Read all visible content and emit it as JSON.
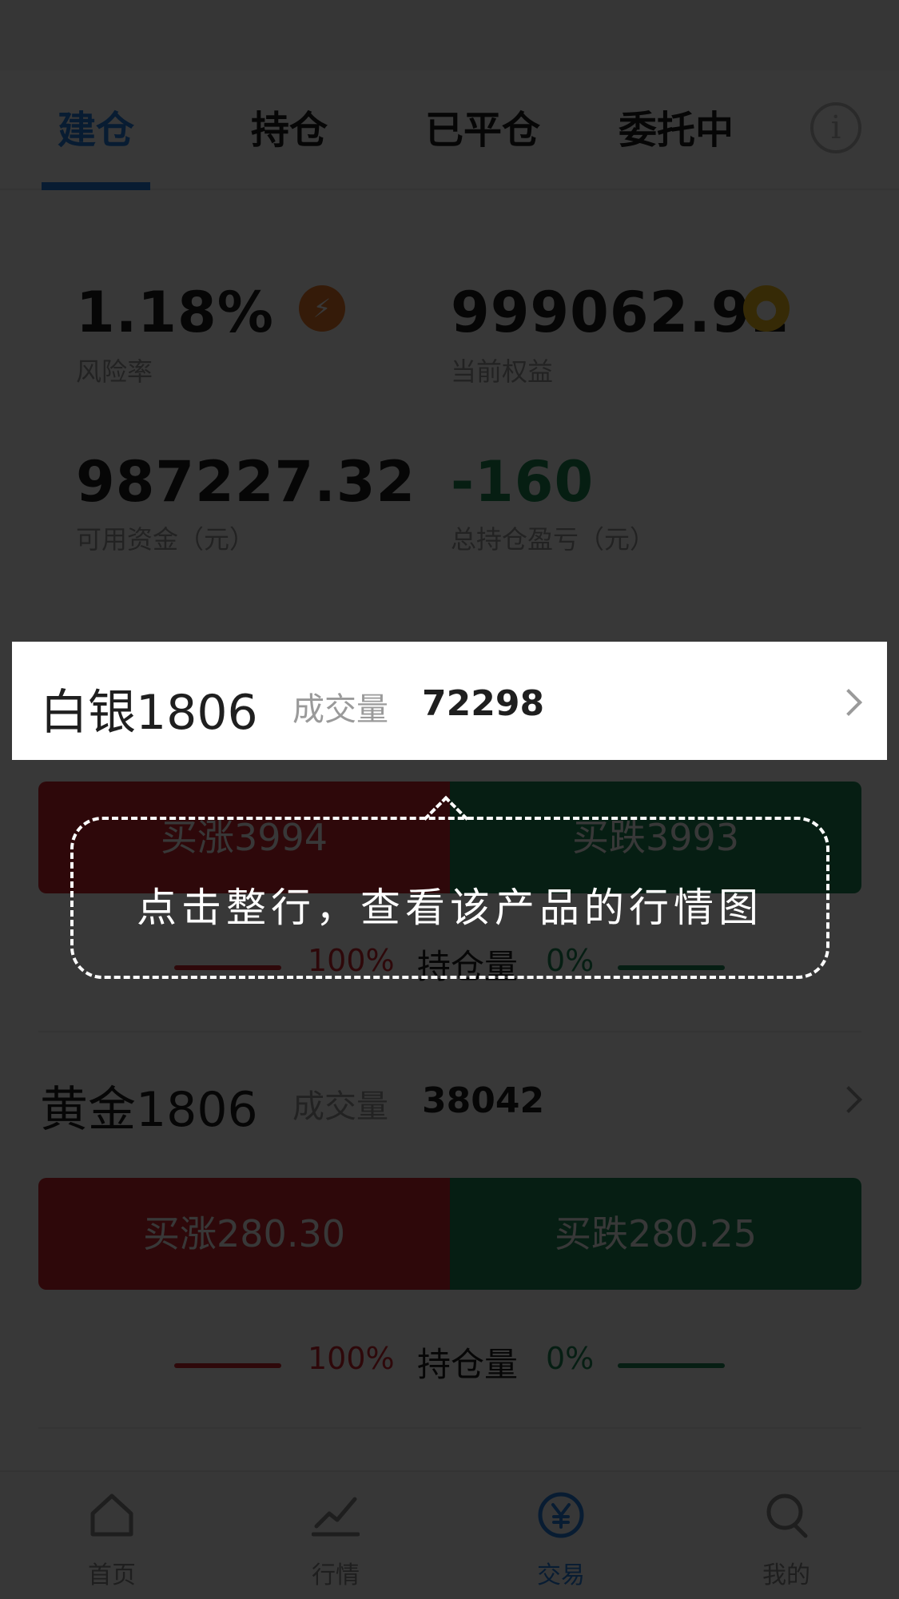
{
  "tabs": [
    {
      "label": "建仓",
      "active": true
    },
    {
      "label": "持仓",
      "active": false
    },
    {
      "label": "已平仓",
      "active": false
    },
    {
      "label": "委托中",
      "active": false
    }
  ],
  "info_icon": "info-circle-icon",
  "summary": {
    "risk_rate": {
      "value": "1.18%",
      "label": "风险率",
      "icon": "lightning-icon",
      "icon_color": "#f07b2a"
    },
    "equity": {
      "value": "999062.92",
      "label": "当前权益",
      "icon": "location-pin-icon",
      "icon_color": "#f3c11e"
    },
    "available_funds": {
      "value": "987227.32",
      "label": "可用资金（元）"
    },
    "total_pnl": {
      "value": "-160",
      "label": "总持仓盈亏（元）",
      "color": "#1c8a55"
    }
  },
  "products": [
    {
      "name": "白银1806",
      "volume_label": "成交量",
      "volume": "72298",
      "buy_up": "买涨3994",
      "buy_down": "买跌3993",
      "position_up": "100%",
      "position_label": "持仓量",
      "position_down": "0%"
    },
    {
      "name": "黄金1806",
      "volume_label": "成交量",
      "volume": "38042",
      "buy_up": "买涨280.30",
      "buy_down": "买跌280.25",
      "position_up": "100%",
      "position_label": "持仓量",
      "position_down": "0%"
    }
  ],
  "tip": {
    "text": "点击整行，查看该产品的行情图"
  },
  "bottom_nav": [
    {
      "label": "首页",
      "icon": "home-icon",
      "active": false
    },
    {
      "label": "行情",
      "icon": "chart-line-icon",
      "active": false
    },
    {
      "label": "交易",
      "icon": "yen-circle-icon",
      "active": true
    },
    {
      "label": "我的",
      "icon": "user-icon",
      "active": false
    }
  ],
  "colors": {
    "accent": "#2780e3",
    "red": "#d0262d",
    "green": "#1d8a56"
  }
}
